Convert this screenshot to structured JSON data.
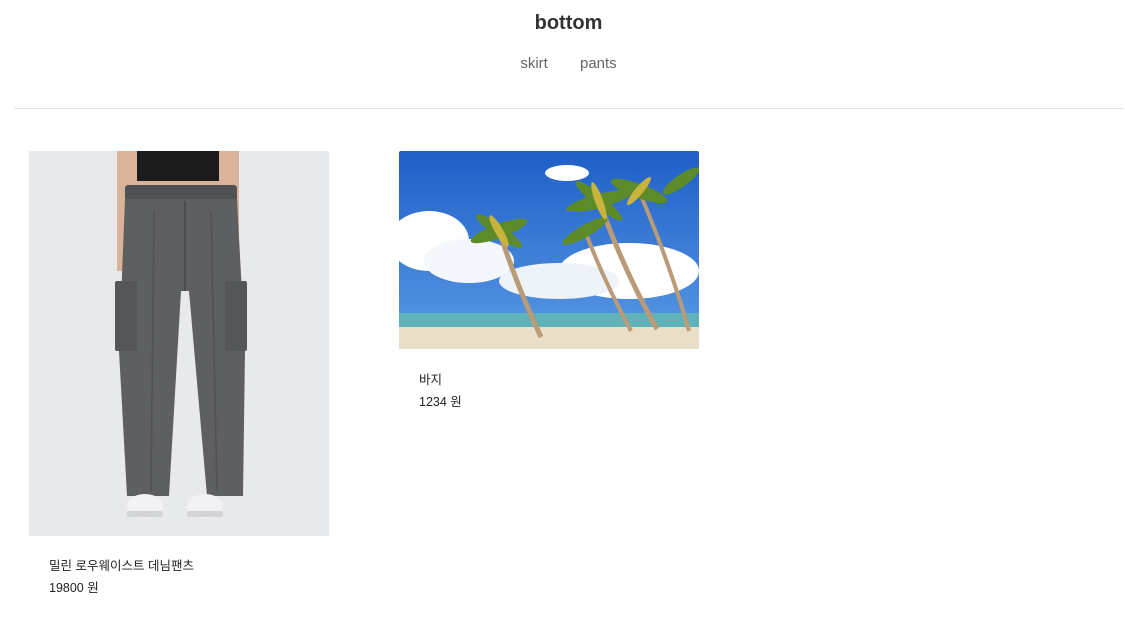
{
  "header": {
    "title": "bottom",
    "nav": [
      {
        "label": "skirt"
      },
      {
        "label": "pants"
      }
    ]
  },
  "products": [
    {
      "name": "밀린 로우웨이스트 데님팬츠",
      "price": "19800 원",
      "image": "gray-cargo-pants-photo"
    },
    {
      "name": "바지",
      "price": "1234 원",
      "image": "palm-beach-photo"
    }
  ],
  "colors": {
    "divider": "#e3e3e3",
    "pants": "#5e5f61",
    "sky": "#2a6fd6",
    "sand": "#e9dfc9"
  }
}
